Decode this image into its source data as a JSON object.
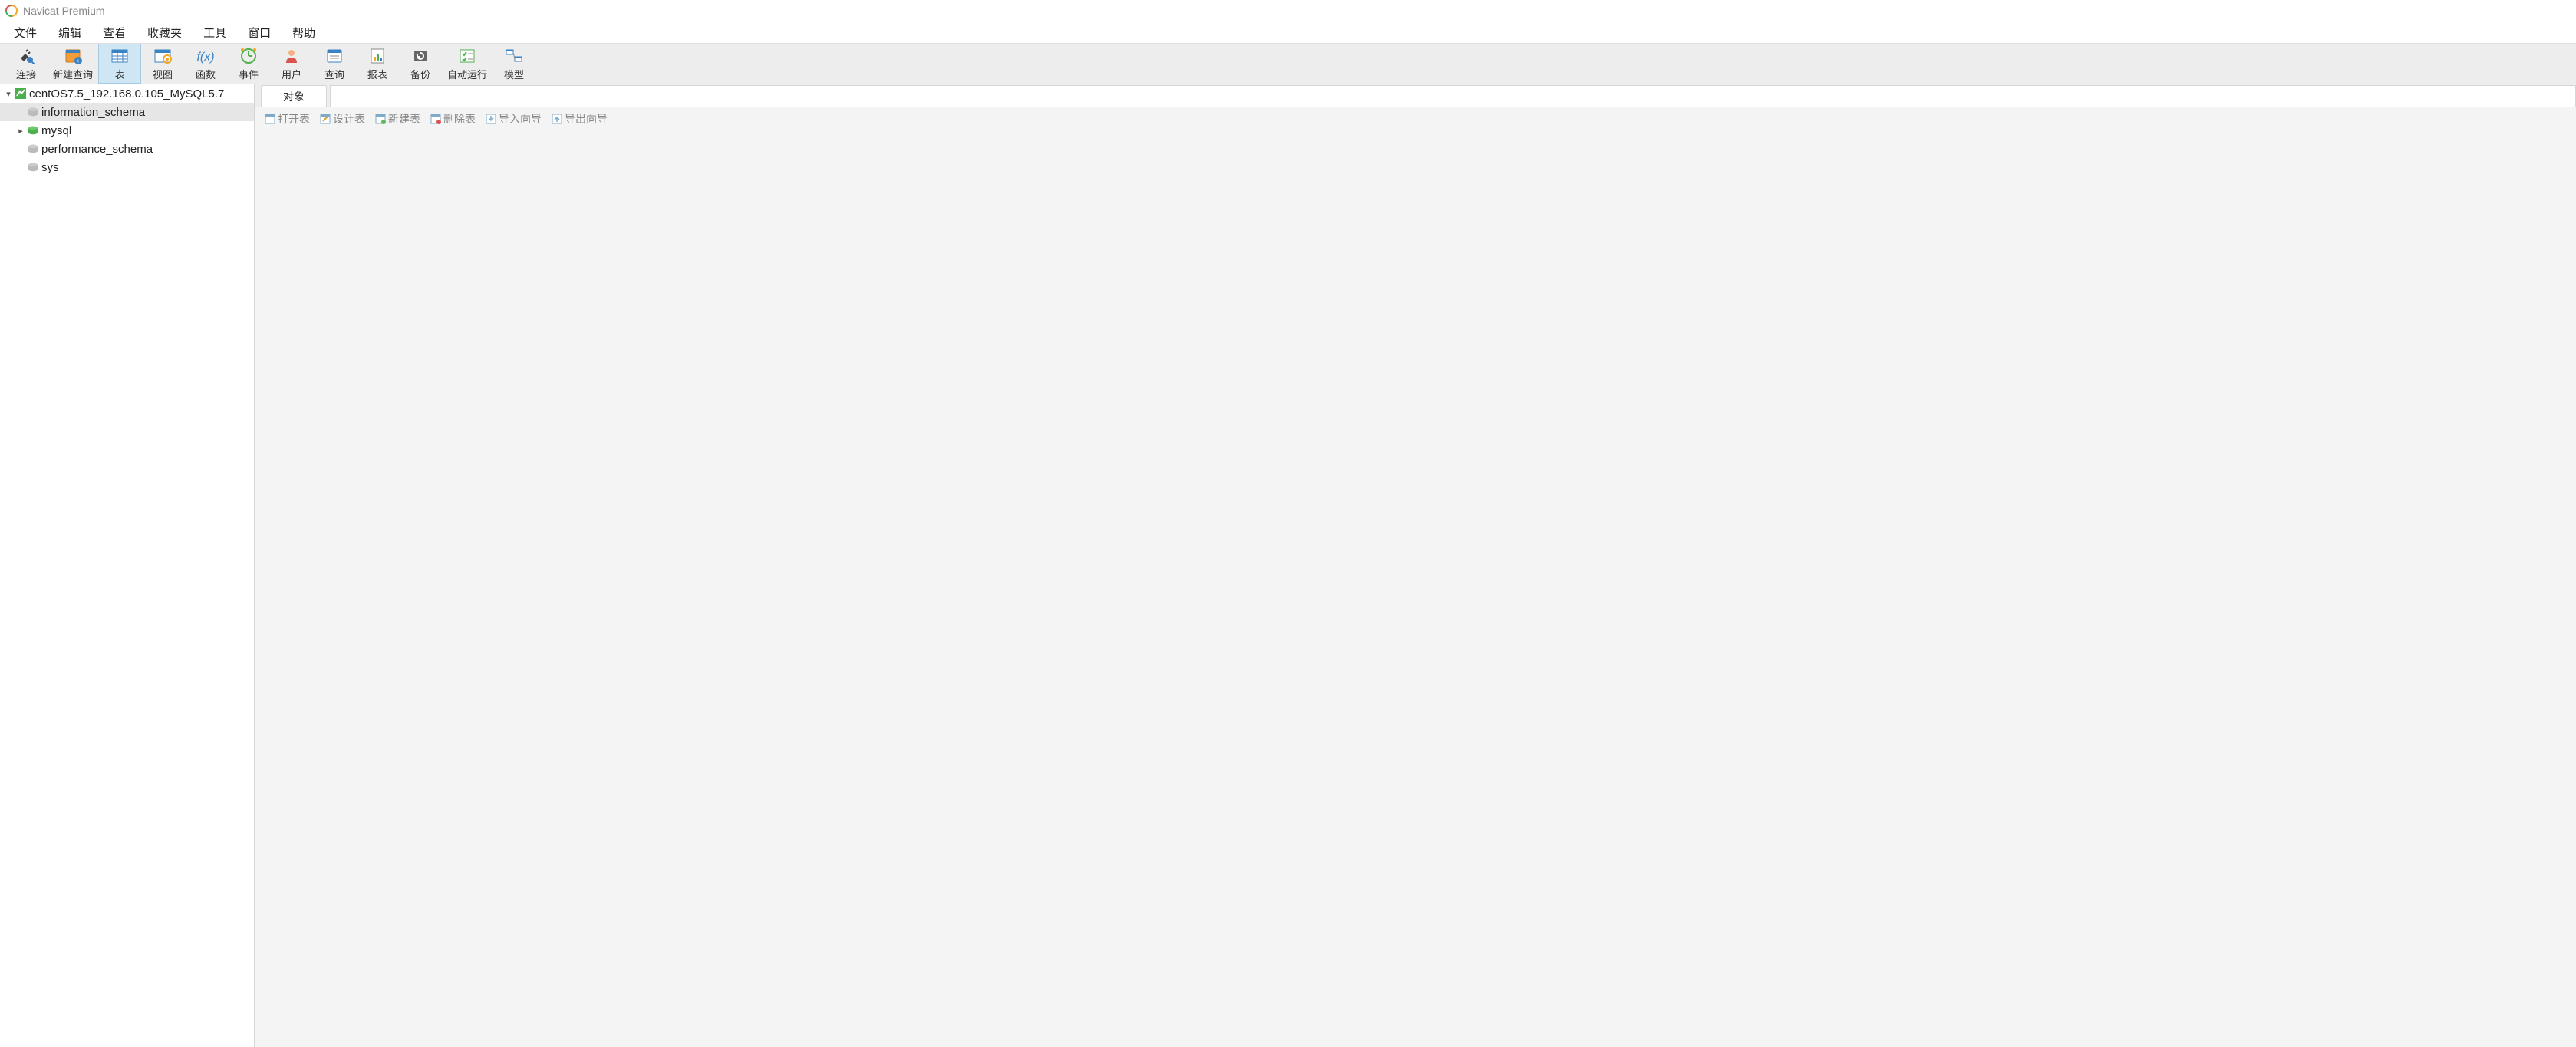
{
  "app": {
    "title": "Navicat Premium"
  },
  "menu": {
    "items": [
      "文件",
      "编辑",
      "查看",
      "收藏夹",
      "工具",
      "窗口",
      "帮助"
    ]
  },
  "toolbar": {
    "buttons": [
      {
        "id": "connect",
        "label": "连接"
      },
      {
        "id": "newquery",
        "label": "新建查询"
      },
      {
        "id": "table",
        "label": "表",
        "active": true
      },
      {
        "id": "view",
        "label": "视图"
      },
      {
        "id": "function",
        "label": "函数"
      },
      {
        "id": "event",
        "label": "事件"
      },
      {
        "id": "user",
        "label": "用户"
      },
      {
        "id": "query",
        "label": "查询"
      },
      {
        "id": "report",
        "label": "报表"
      },
      {
        "id": "backup",
        "label": "备份"
      },
      {
        "id": "autorun",
        "label": "自动运行"
      },
      {
        "id": "model",
        "label": "模型"
      }
    ]
  },
  "tree": {
    "connection": "centOS7.5_192.168.0.105_MySQL5.7",
    "databases": [
      {
        "name": "information_schema",
        "selected": true,
        "expandable": false
      },
      {
        "name": "mysql",
        "selected": false,
        "expandable": true
      },
      {
        "name": "performance_schema",
        "selected": false,
        "expandable": false
      },
      {
        "name": "sys",
        "selected": false,
        "expandable": false
      }
    ]
  },
  "content": {
    "tab": "对象",
    "subtoolbar": [
      "打开表",
      "设计表",
      "新建表",
      "删除表",
      "导入向导",
      "导出向导"
    ]
  }
}
